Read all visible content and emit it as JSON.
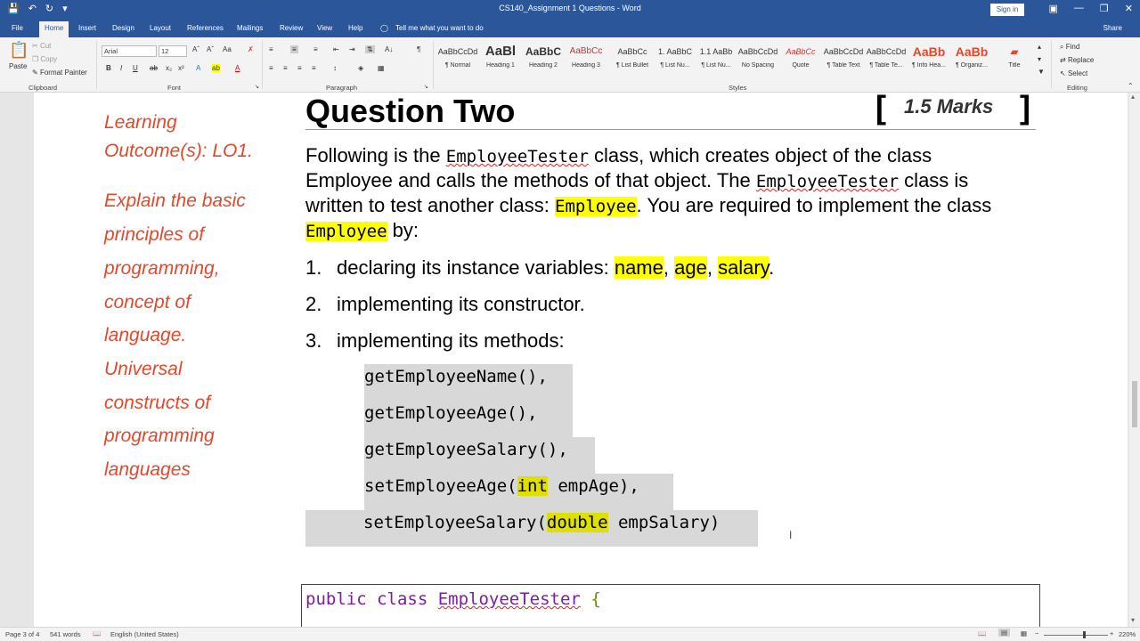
{
  "titlebar": {
    "title": "CS140_Assignment 1 Questions  -  Word",
    "sign_in": "Sign in"
  },
  "tabs": [
    "File",
    "Home",
    "Insert",
    "Design",
    "Layout",
    "References",
    "Mailings",
    "Review",
    "View",
    "Help"
  ],
  "tell_me": "Tell me what you want to do",
  "share": "Share",
  "ribbon": {
    "clipboard": {
      "paste": "Paste",
      "cut": "Cut",
      "copy": "Copy",
      "format_painter": "Format Painter",
      "label": "Clipboard"
    },
    "font": {
      "name": "Arial",
      "size": "12",
      "label": "Font"
    },
    "paragraph_label": "Paragraph",
    "styles": [
      {
        "sample": "AaBbCcDd",
        "label": "¶ Normal"
      },
      {
        "sample": "AaBl",
        "label": "Heading 1"
      },
      {
        "sample": "AaBbC",
        "label": "Heading 2"
      },
      {
        "sample": "AaBbCc",
        "label": "Heading 3"
      },
      {
        "sample": "AaBbCc",
        "label": "¶ List Bullet"
      },
      {
        "sample": "1. AaBbC",
        "label": "¶ List Nu..."
      },
      {
        "sample": "1.1 AaBb",
        "label": "¶ List Nu..."
      },
      {
        "sample": "AaBbCcDd",
        "label": "No Spacing"
      },
      {
        "sample": "AaBbCc",
        "label": "Quote"
      },
      {
        "sample": "AaBbCcDd",
        "label": "¶ Table Text"
      },
      {
        "sample": "AaBbCcDd",
        "label": "¶ Table Te..."
      },
      {
        "sample": "AaBb",
        "label": "¶ Info Hea..."
      },
      {
        "sample": "AaBb",
        "label": "¶ Organiz..."
      },
      {
        "sample": "",
        "label": "Title"
      }
    ],
    "styles_label": "Styles",
    "editing": {
      "find": "Find",
      "replace": "Replace",
      "select": "Select",
      "label": "Editing"
    }
  },
  "document": {
    "learning_outcome": [
      "Learning",
      "Outcome(s): LO1."
    ],
    "lo_description": [
      "Explain the basic",
      "principles of",
      "programming,",
      "concept of",
      "language.",
      "Universal",
      "constructs of",
      "programming",
      "languages"
    ],
    "heading": "Question Two",
    "marks": "1.5 Marks",
    "intro": {
      "l1_a": "Following  is  the ",
      "l1_code": "EmployeeTester",
      "l1_b": " class,  which  creates  object  of  the  class",
      "l2_a": "Employee and calls the methods of that object. The ",
      "l2_code": "EmployeeTester",
      "l2_b": "  class is",
      "l3_a": "written to test another class: ",
      "l3_code": "Employee",
      "l3_b": ". You are required to implement the class",
      "l4_code": "Employee",
      "l4_b": " by:"
    },
    "items": {
      "i1_num": "1.",
      "i1_text": "declaring its instance variables: ",
      "v_name": "name",
      "comma": ", ",
      "v_age": "age",
      "v_salary": "salary",
      "period": ".",
      "i2_num": "2.",
      "i2_text": "implementing its constructor.",
      "i3_num": "3.",
      "i3_text": "implementing its methods:"
    },
    "methods": {
      "m1": "getEmployeeName(),",
      "m2": "getEmployeeAge(),",
      "m3": "getEmployeeSalary(),",
      "m4_a": "setEmployeeAge(",
      "m4_kw": "int",
      "m4_b": " empAge),",
      "m5_a": "setEmployeeSalary(",
      "m5_kw": "double",
      "m5_b": " empSalary)"
    },
    "code": {
      "kw": "public class ",
      "cls": "EmployeeTester",
      "brace": " {"
    }
  },
  "status": {
    "page": "Page 3 of 4",
    "words": "541 words",
    "language": "English (United States)",
    "zoom": "220%"
  }
}
